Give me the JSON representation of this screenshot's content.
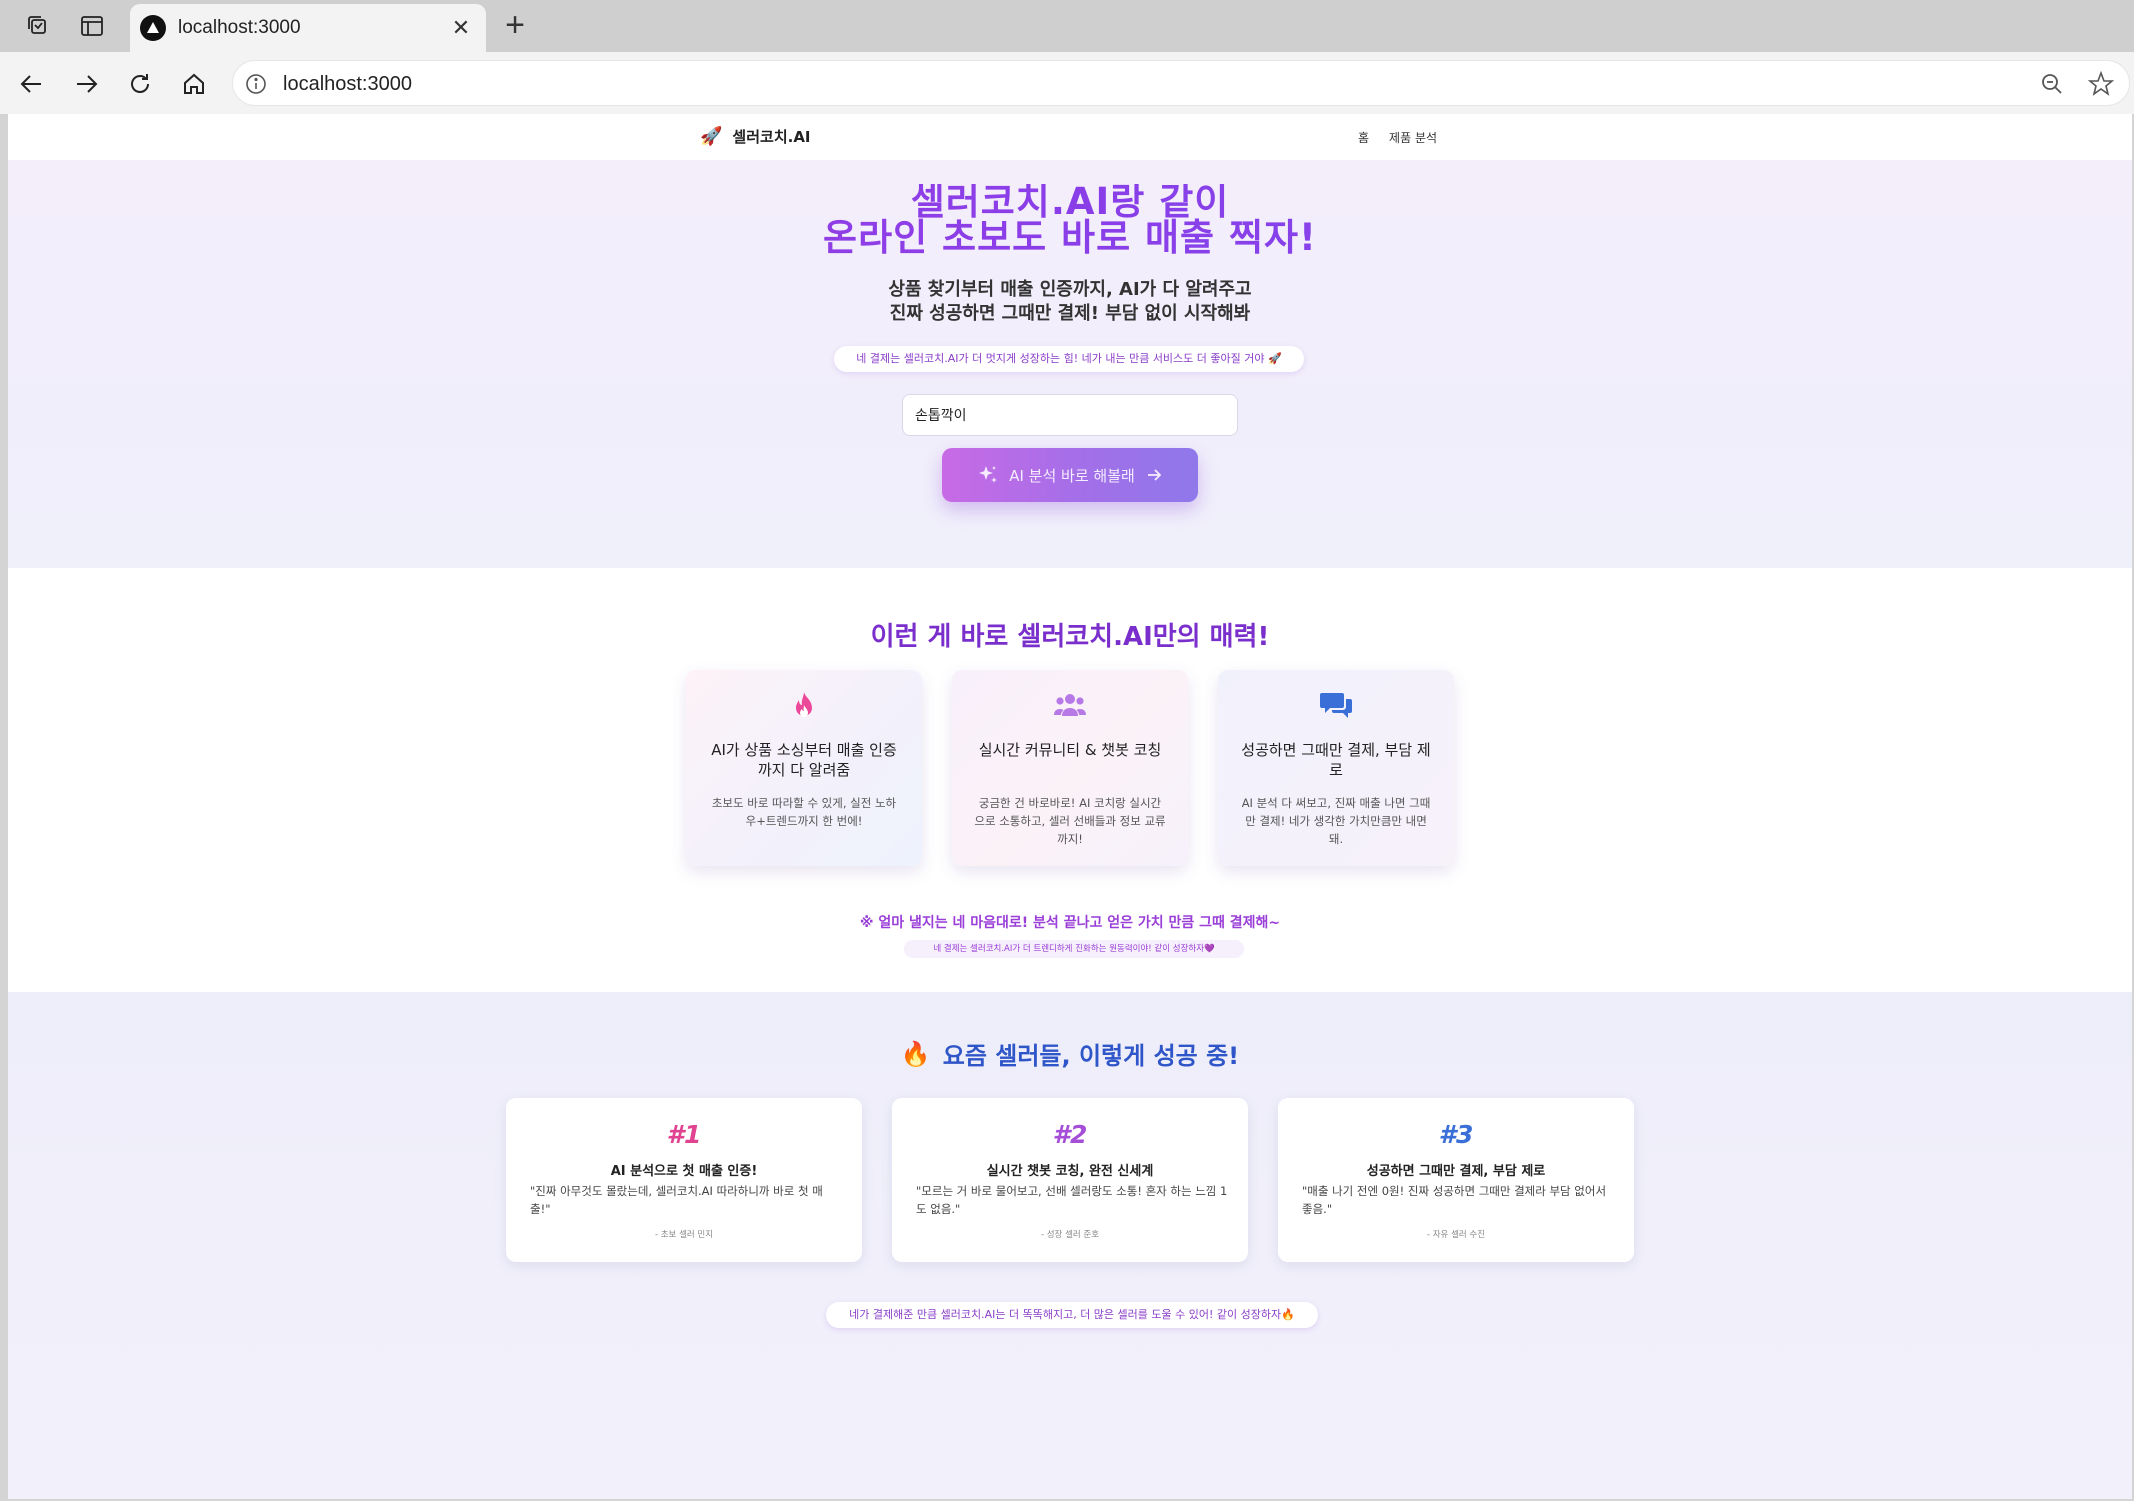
{
  "browser": {
    "tab_title": "localhost:3000",
    "url": "localhost:3000",
    "icons": [
      "collections-icon",
      "sidebar-icon",
      "vercel-favicon",
      "close-icon",
      "new-tab-icon",
      "back-icon",
      "forward-icon",
      "reload-icon",
      "home-icon",
      "site-info-icon",
      "zoom-icon",
      "favorite-star-icon"
    ]
  },
  "header": {
    "brand_icon": "🚀",
    "brand_name": "셀러코치.AI",
    "nav": [
      "홈",
      "제품 분석"
    ]
  },
  "hero": {
    "title_line1": "셀러코치.AI랑 같이",
    "title_line2": "온라인 초보도 바로 매출 찍자!",
    "sub_line1": "상품 찾기부터 매출 인증까지, AI가 다 알려주고",
    "sub_line2": "진짜 성공하면 그때만 결제! 부담 없이 시작해봐",
    "pill": "네 결제는 셀러코치.AI가 더 멋지게 성장하는 힘! 네가 내는 만큼 서비스도 더 좋아질 거야 🚀",
    "search_value": "손톱깍이",
    "cta_label": "AI 분석 바로 해볼래"
  },
  "features": {
    "title": "이런 게 바로 셀러코치.AI만의 매력!",
    "cards": [
      {
        "icon": "fire-icon",
        "title": "AI가 상품 소싱부터 매출 인증까지 다 알려줌",
        "desc": "초보도 바로 따라할 수 있게, 실전 노하우+트렌드까지 한 번에!"
      },
      {
        "icon": "users-icon",
        "title": "실시간 커뮤니티 & 챗봇 코칭",
        "desc": "궁금한 건 바로바로! AI 코치랑 실시간으로 소통하고, 셀러 선배들과 정보 교류까지!"
      },
      {
        "icon": "chat-icon",
        "title": "성공하면 그때만 결제, 부담 제로",
        "desc": "AI 분석 다 써보고, 진짜 매출 나면 그때만 결제! 네가 생각한 가치만큼만 내면 돼."
      }
    ],
    "note": "※ 얼마 낼지는 네 마음대로! 분석 끝나고 얻은 가치 만큼 그때 결제해~",
    "subnote": "네 결제는 셀러코치.AI가 더 트렌디하게 진화하는 원동력이야! 같이 성장하자💜"
  },
  "stories": {
    "title_icon": "🔥",
    "title": "요즘 셀러들, 이렇게 성공 중!",
    "cards": [
      {
        "rank": "#1",
        "title": "AI 분석으로 첫 매출 인증!",
        "quote": "\"진짜 아무것도 몰랐는데, 셀러코치.AI 따라하니까 바로 첫 매출!\"",
        "author": "- 초보 셀러 민지"
      },
      {
        "rank": "#2",
        "title": "실시간 챗봇 코칭, 완전 신세계",
        "quote": "\"모르는 거 바로 물어보고, 선배 셀러랑도 소통! 혼자 하는 느낌 1도 없음.\"",
        "author": "- 성장 셀러 준호"
      },
      {
        "rank": "#3",
        "title": "성공하면 그때만 결제, 부담 제로",
        "quote": "\"매출 나기 전엔 0원! 진짜 성공하면 그때만 결제라 부담 없어서 좋음.\"",
        "author": "- 자유 셀러 수진"
      }
    ],
    "pill": "네가 결제해준 만큼 셀러코치.AI는 더 똑똑해지고, 더 많은 셀러를 도울 수 있어! 같이 성장하자🔥"
  },
  "colors": {
    "accent_purple": "#8a3ee8",
    "rank1": "#e0438f",
    "rank2": "#a54fd8",
    "rank3": "#3b6fd8",
    "stories_title": "#2f56c8"
  }
}
